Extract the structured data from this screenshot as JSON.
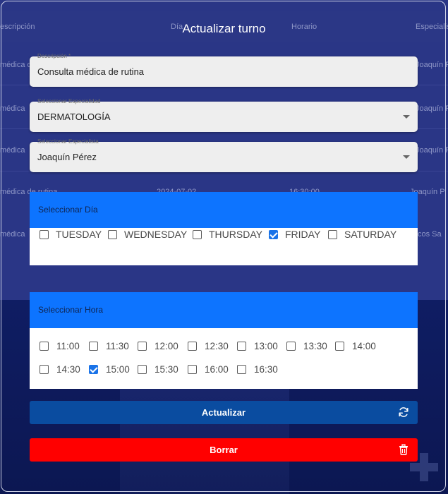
{
  "background_table": {
    "headers": [
      "escripción",
      "Día",
      "Horario",
      "Especialis"
    ],
    "rows": [
      {
        "desc": "médica de rutina",
        "dia": "",
        "hora": "",
        "esp": "Joaquín P"
      },
      {
        "desc": "médica",
        "dia": "",
        "hora": "",
        "esp": "Joaquín P"
      },
      {
        "desc": "médica",
        "dia": "",
        "hora": "",
        "esp": "Joaquín P"
      },
      {
        "desc": "médica de rutina",
        "dia": "2024-07-02",
        "hora": "16:30:00",
        "esp": "Joaquín P"
      },
      {
        "desc": "médica",
        "dia": "",
        "hora": "",
        "esp": "cos Sa"
      }
    ]
  },
  "modal": {
    "title": "Actualizar turno",
    "descripcion": {
      "label": "Descripción *",
      "value": "Consulta médica de rutina"
    },
    "especialidad": {
      "label": "Seleccionar Especialidad",
      "value": "DERMATOLOGÍA"
    },
    "especialista": {
      "label": "Seleccionar Especialista",
      "value": "Joaquín Pérez"
    },
    "dia": {
      "title": "Seleccionar Día",
      "options": [
        {
          "label": "TUESDAY",
          "checked": false
        },
        {
          "label": "WEDNESDAY",
          "checked": false
        },
        {
          "label": "THURSDAY",
          "checked": false
        },
        {
          "label": "FRIDAY",
          "checked": true
        },
        {
          "label": "SATURDAY",
          "checked": false
        }
      ]
    },
    "hora": {
      "title": "Seleccionar Hora",
      "options": [
        {
          "label": "11:00",
          "checked": false
        },
        {
          "label": "11:30",
          "checked": false
        },
        {
          "label": "12:00",
          "checked": false
        },
        {
          "label": "12:30",
          "checked": false
        },
        {
          "label": "13:00",
          "checked": false
        },
        {
          "label": "13:30",
          "checked": false
        },
        {
          "label": "14:00",
          "checked": false
        },
        {
          "label": "14:30",
          "checked": false
        },
        {
          "label": "15:00",
          "checked": true
        },
        {
          "label": "15:30",
          "checked": false
        },
        {
          "label": "16:00",
          "checked": false
        },
        {
          "label": "16:30",
          "checked": false
        }
      ]
    },
    "update_button": {
      "label": "Actualizar",
      "icon": "refresh-icon"
    },
    "delete_button": {
      "label": "Borrar",
      "icon": "trash-icon"
    }
  },
  "colors": {
    "panel_header": "#0d74ff",
    "update_button": "#0a4ca0",
    "delete_button": "#ff0000",
    "check": "#1a73e8"
  }
}
